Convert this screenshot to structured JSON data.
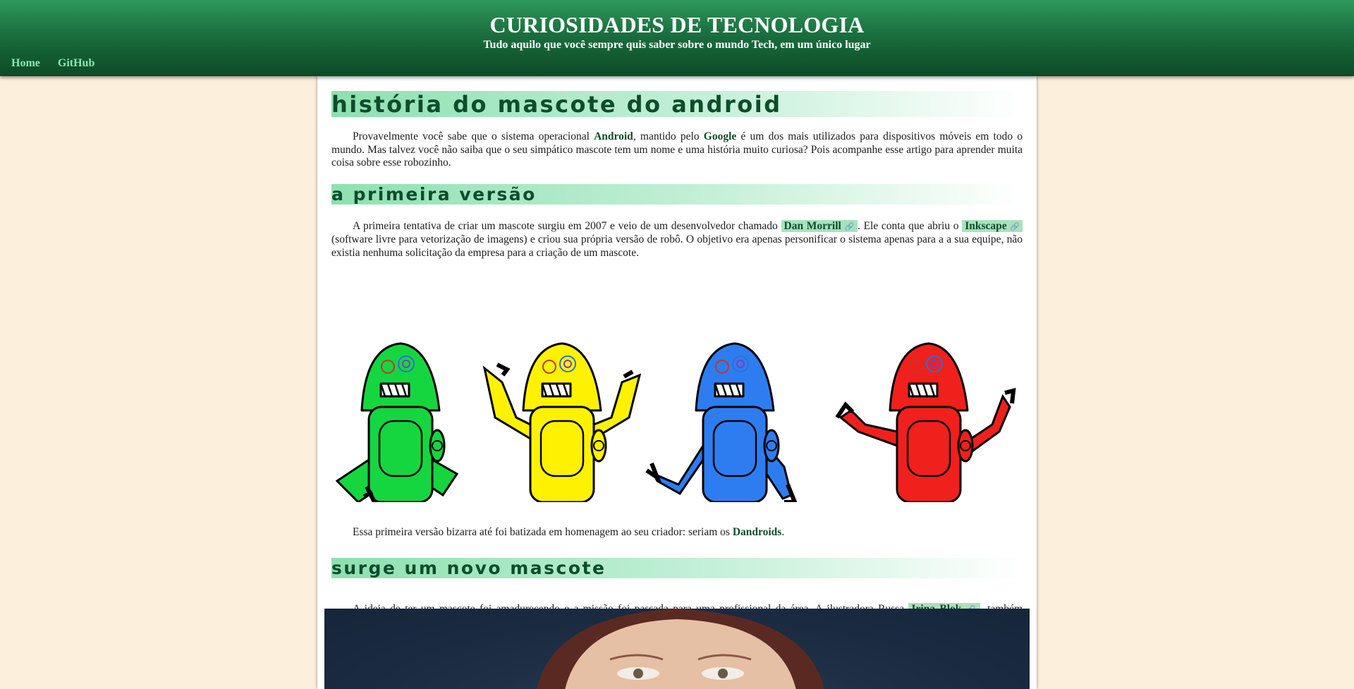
{
  "site": {
    "title": "CURIOSIDADES DE TECNOLOGIA",
    "subtitle": "Tudo aquilo que você sempre quis saber sobre o mundo Tech, em um único lugar"
  },
  "nav": {
    "items": [
      {
        "label": "Home"
      },
      {
        "label": "GitHub"
      }
    ]
  },
  "article": {
    "title": "História do Mascote do Android",
    "intro": {
      "t1": "Provavelmente você sabe que o sistema operacional ",
      "android": "Android",
      "t2": ", mantido pelo ",
      "google": "Google",
      "t3": " é um dos mais utilizados para dispositivos móveis em todo o mundo. Mas talvez você não saiba que o seu simpático mascote tem um nome e uma história muito curiosa? Pois acompanhe esse artigo para aprender muita coisa sobre esse robozinho."
    },
    "section1": {
      "heading": "A primeira versão",
      "p1": {
        "t1": "A primeira tentativa de criar um mascote surgiu em 2007 e veio de um desenvolvedor chamado ",
        "link1": "Dan Morrill",
        "t2": ". Ele conta que abriu o ",
        "link2": "Inkscape",
        "t3": " (software livre para vetorização de imagens) e criou sua própria versão de robô. O objetivo era apenas personificar o sistema apenas para a a sua equipe, não existia nenhuma solicitação da empresa para a criação de um mascote."
      },
      "p2": {
        "t1": "Essa primeira versão bizarra até foi batizada em homenagem ao seu criador: seriam os ",
        "dandroids": "Dandroids",
        "t2": "."
      }
    },
    "section2": {
      "heading": "Surge um novo mascote",
      "p1": {
        "t1": "A ideia de ter um mascote foi amadurecendo e a missão foi passada para uma profissional da área. A ilustradora Russa ",
        "link": "Irina Blok",
        "t2": ", também funcionária do Google, ficou com a missão de representar o pequeno robô de uma maneira mais agradável."
      }
    },
    "link_icon": "🔗"
  },
  "colors": {
    "header_dark": "#0c4a26",
    "header_light": "#2e9a5c",
    "nav_link": "#8ee6b0",
    "page_bg": "#fcefdc",
    "heading_text": "#0d4d2a",
    "link_highlight": "#a8e2bd",
    "robot_colors": [
      "#16d640",
      "#fff200",
      "#2e7df0",
      "#f0201c"
    ]
  }
}
